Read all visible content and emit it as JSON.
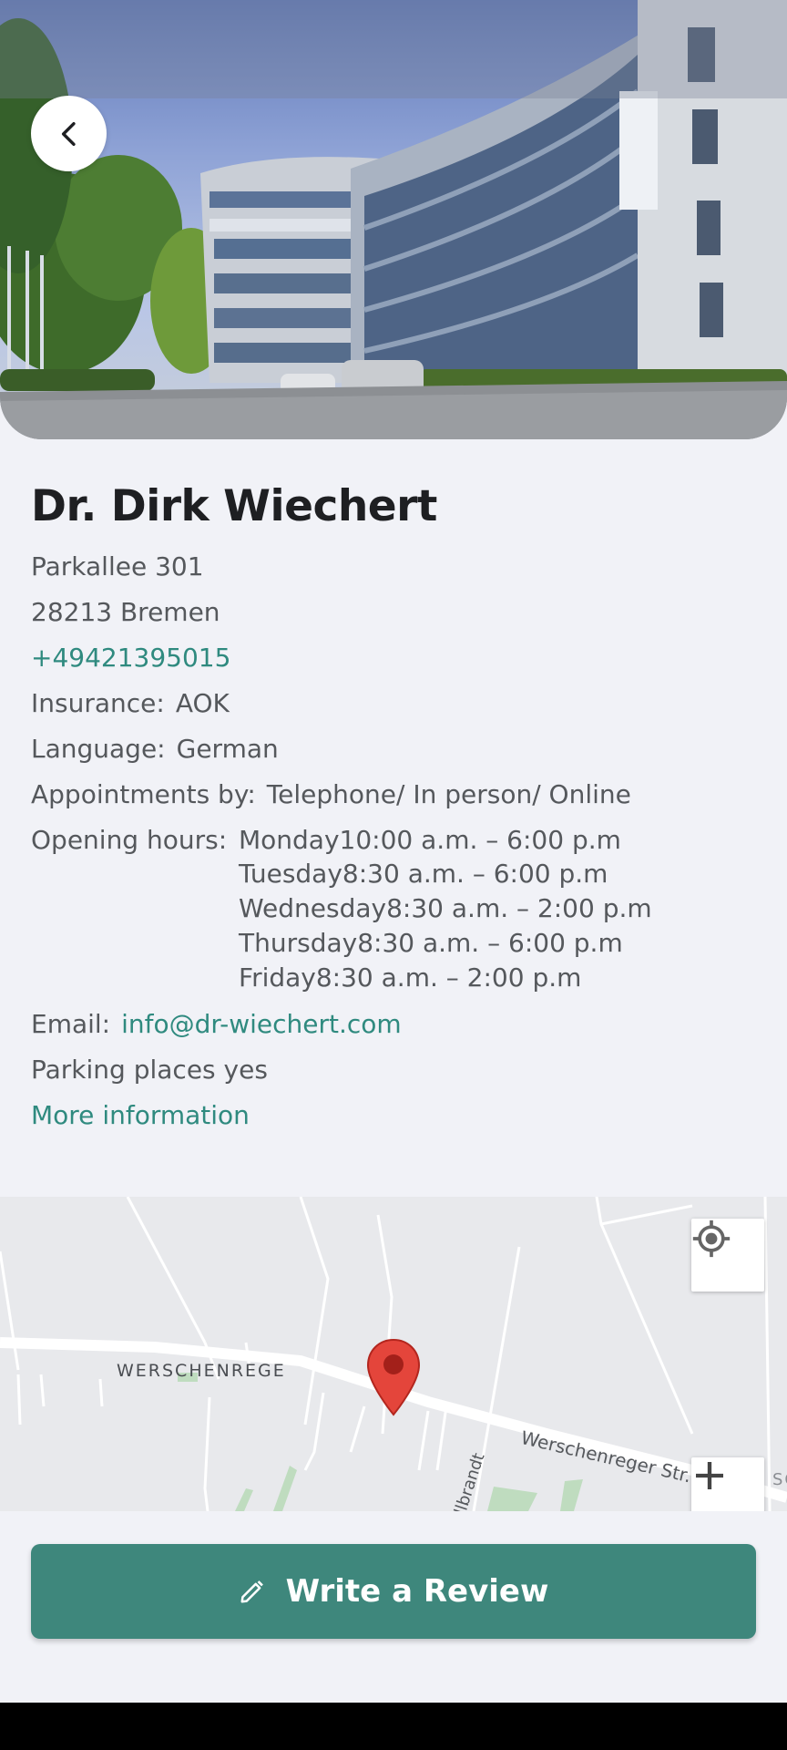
{
  "hero": {
    "image_alt": "Medical office building",
    "back_icon": "chevron-left-icon"
  },
  "doctor": {
    "name": "Dr. Dirk Wiechert",
    "street": "Parkallee 301",
    "city": "28213 Bremen",
    "phone": "+49421395015",
    "insurance_label": "Insurance:",
    "insurance_value": "AOK",
    "language_label": "Language:",
    "language_value": "German",
    "appointments_label": "Appointments by:",
    "appointments_value": "Telephone/ In person/ Online",
    "hours_label": "Opening hours:",
    "hours": [
      "Monday10:00 a.m. – 6:00 p.m",
      "Tuesday8:30 a.m. – 6:00 p.m",
      "Wednesday8:30 a.m. – 2:00 p.m",
      "Thursday8:30 a.m. – 6:00 p.m",
      "Friday8:30 a.m. – 2:00 p.m"
    ],
    "email_label": "Email:",
    "email_value": "info@dr-wiechert.com",
    "parking": "Parking places yes",
    "more_info": "More information"
  },
  "map": {
    "labels": {
      "area": "WERSCHENREGE",
      "street": "Werschenreger Str.",
      "side_street": "llbrandt",
      "edge": "SCHA"
    },
    "locate_icon": "my-location-icon",
    "zoom_in_icon": "plus-icon",
    "marker_icon": "map-pin-icon"
  },
  "actions": {
    "write_review": "Write a Review",
    "write_review_icon": "pencil-icon"
  },
  "colors": {
    "accent": "#3e877c",
    "link": "#2f8a7f",
    "background": "#f1f2f7"
  }
}
